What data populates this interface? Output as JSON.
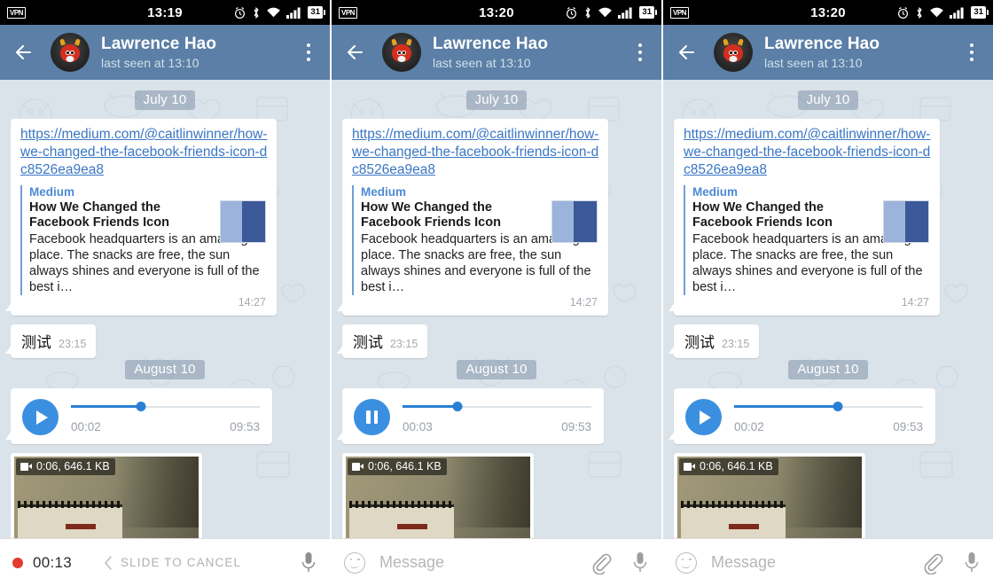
{
  "app": {
    "name": "Telegram",
    "contact": "Lawrence Hao"
  },
  "panels": [
    {
      "id": "panel-1",
      "status": {
        "vpn": "VPN",
        "time": "13:19",
        "battery": "31",
        "icons": [
          "alarm-clock-icon",
          "bluetooth-icon",
          "wifi-icon",
          "signal-bars-icon",
          "battery-icon"
        ]
      },
      "header": {
        "title": "Lawrence Hao",
        "subtitle": "last seen at 13:10",
        "back": "back-arrow-icon",
        "menu": "overflow-menu-icon",
        "avatar": "contact-avatar"
      },
      "date_chip_1": "July 10",
      "link_message": {
        "url": "https://medium.com/@caitlinwinner/how-we-changed-the-facebook-friends-icon-dc8526ea9ea8",
        "site": "Medium",
        "title": "How We Changed the Facebook Friends Icon",
        "description": "Facebook headquarters is an amazing place. The snacks are free, the sun always shines and everyone is full of the best i…",
        "time": "14:27",
        "thumb_left_color": "#9cb3db",
        "thumb_right_color": "#3b5998"
      },
      "text_message": {
        "text": "测试",
        "time": "23:15"
      },
      "date_chip_2": "August 10",
      "audio": {
        "state": "play",
        "position": "00:02",
        "duration": "09:53",
        "progress_pct": 37
      },
      "video": {
        "badge": "0:06, 646.1 KB",
        "icon": "video-camera-icon"
      },
      "bottom": {
        "mode": "recording",
        "rec_time": "00:13",
        "cancel_hint": "SLIDE TO CANCEL",
        "mic": "microphone-icon",
        "chevron": "chevron-left-icon"
      }
    },
    {
      "id": "panel-2",
      "status": {
        "vpn": "VPN",
        "time": "13:20",
        "battery": "31",
        "icons": [
          "alarm-clock-icon",
          "bluetooth-icon",
          "wifi-icon",
          "signal-bars-icon",
          "battery-icon"
        ]
      },
      "header": {
        "title": "Lawrence Hao",
        "subtitle": "last seen at 13:10",
        "back": "back-arrow-icon",
        "menu": "overflow-menu-icon",
        "avatar": "contact-avatar"
      },
      "date_chip_1": "July 10",
      "link_message": {
        "url": "https://medium.com/@caitlinwinner/how-we-changed-the-facebook-friends-icon-dc8526ea9ea8",
        "site": "Medium",
        "title": "How We Changed the Facebook Friends Icon",
        "description": "Facebook headquarters is an amazing place. The snacks are free, the sun always shines and everyone is full of the best i…",
        "time": "14:27",
        "thumb_left_color": "#9cb3db",
        "thumb_right_color": "#3b5998"
      },
      "text_message": {
        "text": "测试",
        "time": "23:15"
      },
      "date_chip_2": "August 10",
      "audio": {
        "state": "pause",
        "position": "00:03",
        "duration": "09:53",
        "progress_pct": 29
      },
      "video": {
        "badge": "0:06, 646.1 KB",
        "icon": "video-camera-icon"
      },
      "bottom": {
        "mode": "input",
        "placeholder": "Message",
        "emoji": "emoji-icon",
        "attach": "paperclip-icon",
        "mic": "microphone-icon"
      }
    },
    {
      "id": "panel-3",
      "status": {
        "vpn": "VPN",
        "time": "13:20",
        "battery": "31",
        "icons": [
          "alarm-clock-icon",
          "bluetooth-icon",
          "wifi-icon",
          "signal-bars-icon",
          "battery-icon"
        ]
      },
      "header": {
        "title": "Lawrence Hao",
        "subtitle": "last seen at 13:10",
        "back": "back-arrow-icon",
        "menu": "overflow-menu-icon",
        "avatar": "contact-avatar"
      },
      "date_chip_1": "July 10",
      "link_message": {
        "url": "https://medium.com/@caitlinwinner/how-we-changed-the-facebook-friends-icon-dc8526ea9ea8",
        "site": "Medium",
        "title": "How We Changed the Facebook Friends Icon",
        "description": "Facebook headquarters is an amazing place. The snacks are free, the sun always shines and everyone is full of the best i…",
        "time": "14:27",
        "thumb_left_color": "#9cb3db",
        "thumb_right_color": "#3b5998"
      },
      "text_message": {
        "text": "测试",
        "time": "23:15"
      },
      "date_chip_2": "August 10",
      "audio": {
        "state": "play",
        "position": "00:02",
        "duration": "09:53",
        "progress_pct": 55
      },
      "video": {
        "badge": "0:06, 646.1 KB",
        "icon": "video-camera-icon"
      },
      "bottom": {
        "mode": "input",
        "placeholder": "Message",
        "emoji": "emoji-icon",
        "attach": "paperclip-icon",
        "mic": "microphone-icon"
      }
    }
  ],
  "colors": {
    "header_blue": "#5b7fa6",
    "chat_bg": "#dbe3ea",
    "accent_blue": "#3b8fe0",
    "link_blue": "#3a76c4",
    "record_red": "#e23b2e",
    "statusbar": "#000000"
  }
}
